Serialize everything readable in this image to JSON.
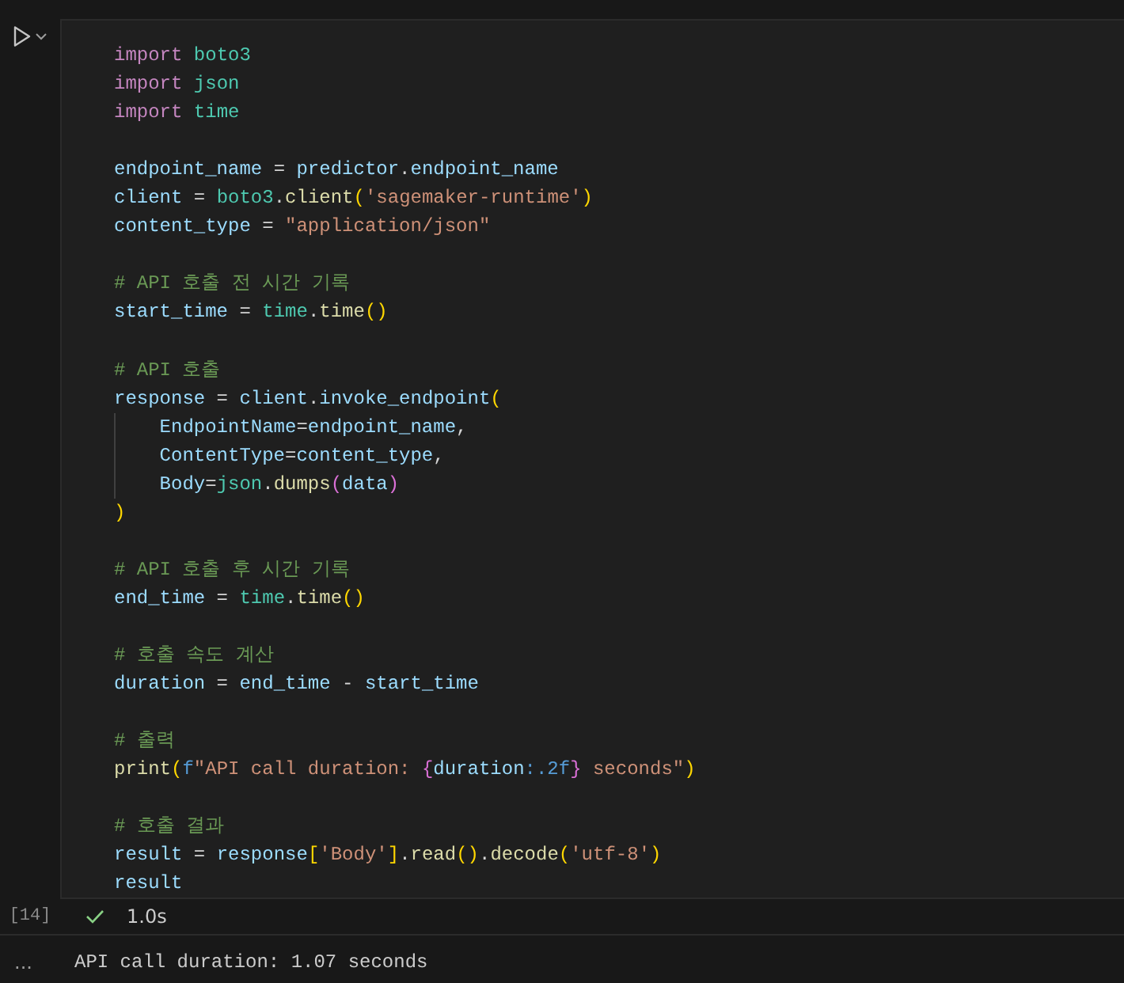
{
  "cell": {
    "execution_count": "[14]",
    "lines": [
      {
        "kind": "code",
        "tokens": [
          {
            "t": "import ",
            "kind": "keyword"
          },
          {
            "t": "boto3",
            "kind": "module"
          }
        ]
      },
      {
        "kind": "code",
        "tokens": [
          {
            "t": "import ",
            "kind": "keyword"
          },
          {
            "t": "json",
            "kind": "module"
          }
        ]
      },
      {
        "kind": "code",
        "tokens": [
          {
            "t": "import ",
            "kind": "keyword"
          },
          {
            "t": "time",
            "kind": "module"
          }
        ]
      },
      {
        "kind": "blank"
      },
      {
        "kind": "code",
        "tokens": [
          {
            "t": "endpoint_name",
            "kind": "var"
          },
          {
            "t": " = "
          },
          {
            "t": "predictor",
            "kind": "var"
          },
          {
            "t": "."
          },
          {
            "t": "endpoint_name",
            "kind": "var"
          }
        ]
      },
      {
        "kind": "code",
        "tokens": [
          {
            "t": "client",
            "kind": "var"
          },
          {
            "t": " = "
          },
          {
            "t": "boto3",
            "kind": "module"
          },
          {
            "t": "."
          },
          {
            "t": "client",
            "kind": "func"
          },
          {
            "t": "(",
            "kind": "bracket1"
          },
          {
            "t": "'sagemaker-runtime'",
            "kind": "string"
          },
          {
            "t": ")",
            "kind": "bracket1"
          }
        ]
      },
      {
        "kind": "code",
        "tokens": [
          {
            "t": "content_type",
            "kind": "var"
          },
          {
            "t": " = "
          },
          {
            "t": "\"application/json\"",
            "kind": "string"
          }
        ]
      },
      {
        "kind": "blank"
      },
      {
        "kind": "code",
        "tokens": [
          {
            "t": "# API 호출 전 시간 기록",
            "kind": "comment"
          }
        ]
      },
      {
        "kind": "code",
        "tokens": [
          {
            "t": "start_time",
            "kind": "var"
          },
          {
            "t": " = "
          },
          {
            "t": "time",
            "kind": "module"
          },
          {
            "t": "."
          },
          {
            "t": "time",
            "kind": "func"
          },
          {
            "t": "()",
            "kind": "bracket1"
          }
        ]
      },
      {
        "kind": "blank"
      },
      {
        "kind": "code",
        "tokens": [
          {
            "t": "# API 호출",
            "kind": "comment"
          }
        ]
      },
      {
        "kind": "code",
        "tokens": [
          {
            "t": "response",
            "kind": "var"
          },
          {
            "t": " = "
          },
          {
            "t": "client",
            "kind": "var"
          },
          {
            "t": "."
          },
          {
            "t": "invoke_endpoint",
            "kind": "var"
          },
          {
            "t": "(",
            "kind": "bracket1"
          }
        ]
      },
      {
        "kind": "code",
        "indented": true,
        "tokens": [
          {
            "t": "EndpointName",
            "kind": "var"
          },
          {
            "t": "="
          },
          {
            "t": "endpoint_name",
            "kind": "var"
          },
          {
            "t": ","
          }
        ]
      },
      {
        "kind": "code",
        "indented": true,
        "tokens": [
          {
            "t": "ContentType",
            "kind": "var"
          },
          {
            "t": "="
          },
          {
            "t": "content_type",
            "kind": "var"
          },
          {
            "t": ","
          }
        ]
      },
      {
        "kind": "code",
        "indented": true,
        "tokens": [
          {
            "t": "Body",
            "kind": "var"
          },
          {
            "t": "="
          },
          {
            "t": "json",
            "kind": "module"
          },
          {
            "t": "."
          },
          {
            "t": "dumps",
            "kind": "func"
          },
          {
            "t": "(",
            "kind": "bracket2"
          },
          {
            "t": "data",
            "kind": "var"
          },
          {
            "t": ")",
            "kind": "bracket2"
          }
        ]
      },
      {
        "kind": "code",
        "tokens": [
          {
            "t": ")",
            "kind": "bracket1"
          }
        ]
      },
      {
        "kind": "blank"
      },
      {
        "kind": "code",
        "tokens": [
          {
            "t": "# API 호출 후 시간 기록",
            "kind": "comment"
          }
        ]
      },
      {
        "kind": "code",
        "tokens": [
          {
            "t": "end_time",
            "kind": "var"
          },
          {
            "t": " = "
          },
          {
            "t": "time",
            "kind": "module"
          },
          {
            "t": "."
          },
          {
            "t": "time",
            "kind": "func"
          },
          {
            "t": "()",
            "kind": "bracket1"
          }
        ]
      },
      {
        "kind": "blank"
      },
      {
        "kind": "code",
        "tokens": [
          {
            "t": "# 호출 속도 계산",
            "kind": "comment"
          }
        ]
      },
      {
        "kind": "code",
        "tokens": [
          {
            "t": "duration",
            "kind": "var"
          },
          {
            "t": " = "
          },
          {
            "t": "end_time",
            "kind": "var"
          },
          {
            "t": " - "
          },
          {
            "t": "start_time",
            "kind": "var"
          }
        ]
      },
      {
        "kind": "blank"
      },
      {
        "kind": "code",
        "tokens": [
          {
            "t": "# 출력",
            "kind": "comment"
          }
        ]
      },
      {
        "kind": "code",
        "tokens": [
          {
            "t": "print",
            "kind": "func"
          },
          {
            "t": "(",
            "kind": "bracket1"
          },
          {
            "t": "f",
            "kind": "storage"
          },
          {
            "t": "\"API call duration: ",
            "kind": "string"
          },
          {
            "t": "{",
            "kind": "bracket2"
          },
          {
            "t": "duration",
            "kind": "var"
          },
          {
            "t": ":.2f",
            "kind": "storage"
          },
          {
            "t": "}",
            "kind": "bracket2"
          },
          {
            "t": " seconds\"",
            "kind": "string"
          },
          {
            "t": ")",
            "kind": "bracket1"
          }
        ]
      },
      {
        "kind": "blank"
      },
      {
        "kind": "code",
        "tokens": [
          {
            "t": "# 호출 결과",
            "kind": "comment"
          }
        ]
      },
      {
        "kind": "code",
        "tokens": [
          {
            "t": "result",
            "kind": "var"
          },
          {
            "t": " = "
          },
          {
            "t": "response",
            "kind": "var"
          },
          {
            "t": "[",
            "kind": "bracket1"
          },
          {
            "t": "'Body'",
            "kind": "string"
          },
          {
            "t": "]",
            "kind": "bracket1"
          },
          {
            "t": "."
          },
          {
            "t": "read",
            "kind": "func"
          },
          {
            "t": "()",
            "kind": "bracket1"
          },
          {
            "t": "."
          },
          {
            "t": "decode",
            "kind": "func"
          },
          {
            "t": "(",
            "kind": "bracket1"
          },
          {
            "t": "'utf-8'",
            "kind": "string"
          },
          {
            "t": ")",
            "kind": "bracket1"
          }
        ]
      },
      {
        "kind": "code",
        "tokens": [
          {
            "t": "result",
            "kind": "var"
          }
        ]
      }
    ],
    "status": {
      "succeeded": true,
      "duration": "1.0s"
    }
  },
  "output": {
    "more": "...",
    "text": "API call duration: 1.07 seconds"
  }
}
